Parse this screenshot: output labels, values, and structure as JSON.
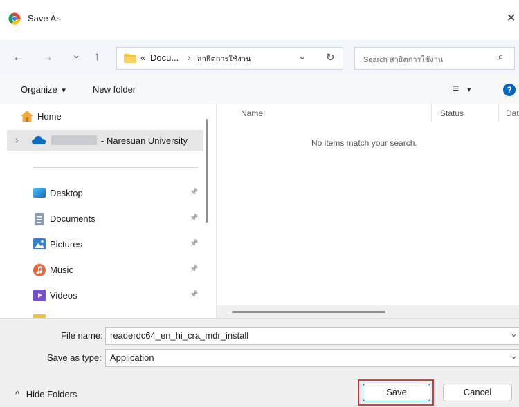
{
  "window": {
    "title": "Save As",
    "close_glyph": "✕"
  },
  "nav": {
    "back_glyph": "←",
    "forward_glyph": "→",
    "recent_glyph": "⌄",
    "up_glyph": "↑",
    "breadcrumb": {
      "overflow": "«",
      "segment1": "Docu...",
      "separator": "›",
      "segment2": "สาธิตการใช้งาน",
      "dropdown_glyph": "⌄"
    },
    "refresh_glyph": "↻",
    "search": {
      "placeholder": "Search สาธิตการใช้งาน",
      "icon_glyph": "⌕"
    }
  },
  "toolbar": {
    "organize_label": "Organize",
    "organize_caret": "▾",
    "new_folder_label": "New folder",
    "view_glyph": "≡",
    "view_caret": "▾",
    "help_glyph": "?"
  },
  "sidebar": {
    "home_label": "Home",
    "onedrive_label": "- Naresuan University",
    "expand_glyph": "›",
    "items": [
      {
        "label": "Desktop",
        "pin": "📌"
      },
      {
        "label": "Documents",
        "pin": "📌"
      },
      {
        "label": "Pictures",
        "pin": "📌"
      },
      {
        "label": "Music",
        "pin": "📌"
      },
      {
        "label": "Videos",
        "pin": "📌"
      }
    ]
  },
  "content": {
    "columns": [
      "Name",
      "Status",
      "Dat"
    ],
    "empty_message": "No items match your search."
  },
  "form": {
    "file_name_label": "File name:",
    "file_name_value": "readerdc64_en_hi_cra_mdr_install",
    "save_type_label": "Save as type:",
    "save_type_value": "Application",
    "dropdown_glyph": "⌄"
  },
  "footer": {
    "hide_folders_glyph": "^",
    "hide_folders_label": "Hide Folders",
    "save_label": "Save",
    "cancel_label": "Cancel"
  },
  "colors": {
    "accent": "#0067c0",
    "highlight_border": "#e03a3a",
    "selected_bg": "#e6e6e6"
  }
}
